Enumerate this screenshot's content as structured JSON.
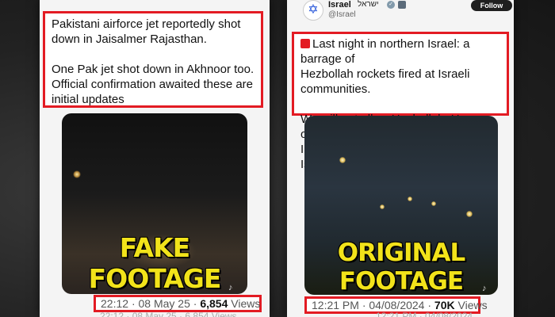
{
  "left_post": {
    "text": "Pakistani airforce jet reportedly shot\ndown in Jaisalmer Rajasthan.\n\nOne Pak jet shot down in Akhnoor too.\nOfficial confirmation awaited these are\ninitial updates",
    "overlay_label": "FAKE FOOTAGE",
    "time": "22:12",
    "sep": "·",
    "date": "08 May 25",
    "dot": "·",
    "views_count": "6,854",
    "views_label": "Views",
    "ghost_footer": "22:12 · 08 May 25 · 6,854 Views"
  },
  "right_post": {
    "account_name": "Israel",
    "account_hebrew": "ישראל",
    "handle": "@Israel",
    "follow_label": "Follow",
    "text": "Last night in northern Israel: a barrage of\nHezbollah rockets fired at Israeli communities.\n\nWe will not allow Hezbollah, Hamas or any other\nIranian proxy to harm the people of Israel.",
    "overlay_label": "ORIGINAL FOOTAGE",
    "time": "12:21 PM",
    "sep": "·",
    "date": "04/08/2024",
    "dot": "·",
    "views_count": "70K",
    "views_label": "Views",
    "ghost_footer": "12:21 PM · 04/08/2024"
  },
  "icons": {
    "avatar": "star-of-david-icon",
    "siren": "police-light-icon",
    "speaker": "speaker-icon"
  },
  "colors": {
    "highlight_border": "#e31b23",
    "overlay_text": "#f2e31a"
  }
}
